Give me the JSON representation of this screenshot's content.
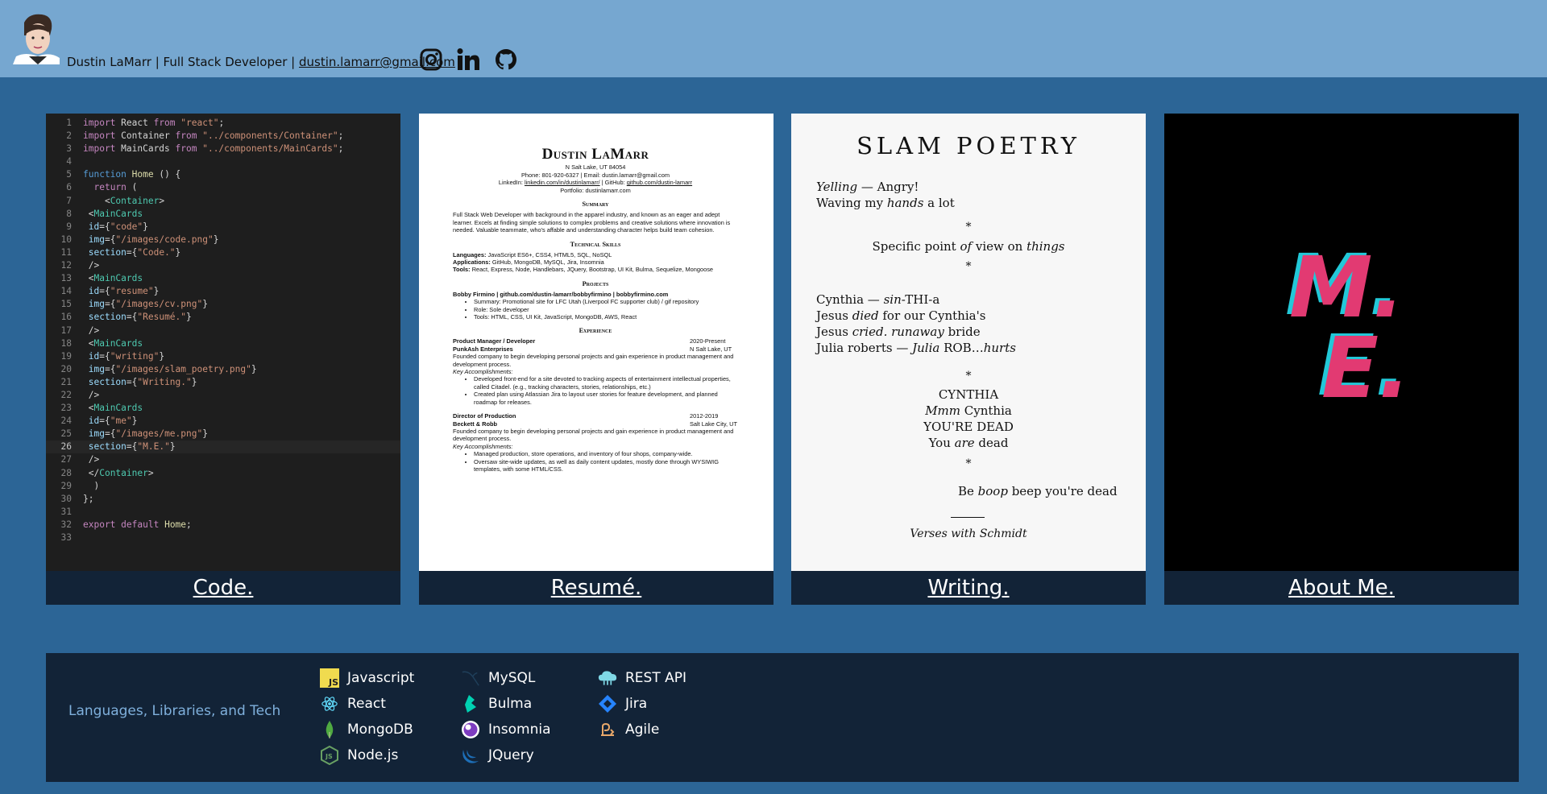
{
  "header": {
    "name_title": "Dustin LaMarr | Full Stack Developer |",
    "email": "dustin.lamarr@gmail.com",
    "social": [
      "instagram-icon",
      "linkedin-icon",
      "github-icon"
    ]
  },
  "cards": [
    {
      "label": "Code."
    },
    {
      "label": "Resumé."
    },
    {
      "label": "Writing."
    },
    {
      "label": "About Me."
    }
  ],
  "code": {
    "lines": [
      "import React from \"react\";",
      "import Container from \"../components/Container\";",
      "import MainCards from \"../components/MainCards\";",
      "",
      "function Home () {",
      "  return (",
      "    <Container>",
      " <MainCards",
      " id={\"code\"}",
      " img={\"/images/code.png\"}",
      " section={\"Code.\"}",
      " />",
      " <MainCards",
      " id={\"resume\"}",
      " img={\"/images/cv.png\"}",
      " section={\"Resumé.\"}",
      " />",
      " <MainCards",
      " id={\"writing\"}",
      " img={\"/images/slam_poetry.png\"}",
      " section={\"Writing.\"}",
      " />",
      " <MainCards",
      " id={\"me\"}",
      " img={\"/images/me.png\"}",
      " section={\"M.E.\"}",
      " />",
      " </Container>",
      "  )",
      "};",
      "",
      "export default Home;",
      ""
    ]
  },
  "resume": {
    "name": "Dustin LaMarr",
    "location": "N Salt Lake, UT 84054",
    "phone_email": "Phone: 801-920-6327 | Email: dustin.lamarr@gmail.com",
    "linkedin_label": "LinkedIn:",
    "linkedin": "linkedin.com/in/dustinlamarr/",
    "github_label": "| GitHub:",
    "github": "github.com/dustin-lamarr",
    "portfolio": "Portfolio: dustinlamarr.com",
    "summary_h": "Summary",
    "summary": "Full Stack Web Developer with background in the apparel industry, and known as an eager and adept learner. Excels at finding simple solutions to complex problems and creative solutions where innovation is needed. Valuable teammate, who's affable and understanding character helps build team cohesion.",
    "skills_h": "Technical Skills",
    "lang_label": "Languages:",
    "lang": "JavaScript ES6+, CSS4, HTML5, SQL, NoSQL",
    "apps_label": "Applications:",
    "apps": "GitHub, MongoDB, MySQL, Jira, Insomnia",
    "tools_label": "Tools:",
    "tools": "React, Express, Node, Handlebars, JQuery, Bootstrap, UI Kit, Bulma, Sequelize, Mongoose",
    "projects_h": "Projects",
    "project_title": "Bobby Firmino | github.com/dustin-lamarr/bobbyfirmino | bobbyfirmino.com",
    "project_items": [
      "Summary: Promotional site for LFC Utah (Liverpool FC supporter club) / gif repository",
      "Role: Sole developer",
      "Tools: HTML, CSS, UI Kit, JavaScript, MongoDB, AWS, React"
    ],
    "exp_h": "Experience",
    "job1_title": "Product Manager / Developer",
    "job1_dates": "2020-Present",
    "job1_company": "PunkAsh Enterprises",
    "job1_loc": "N Salt Lake, UT",
    "job1_desc": "Founded company to begin developing personal projects and gain experience in product management and development process.",
    "key_label": "Key Accomplishments:",
    "job1_items": [
      "Developed front-end for a site devoted to tracking aspects of entertainment intellectual properties, called Citadel. (e.g., tracking characters, stories, relationships, etc.)",
      "Created plan using Atlassian Jira to layout user stories for feature development, and planned roadmap for releases."
    ],
    "job2_title": "Director of Production",
    "job2_dates": "2012-2019",
    "job2_company": "Beckett & Robb",
    "job2_loc": "Salt Lake City, UT",
    "job2_desc": "Founded company to begin developing personal projects and gain experience in product management and development process.",
    "job2_items": [
      "Managed production, store operations, and inventory of four shops, company-wide.",
      "Oversaw site-wide updates, as well as daily content updates, mostly done through WYSIWIG templates, with some HTML/CSS."
    ]
  },
  "poetry": {
    "title": "SLAM POETRY",
    "l1a": "Yelling",
    "l1b": " — Angry!",
    "l2a": "Waving my ",
    "l2b": "hands",
    "l2c": " a lot",
    "star": "*",
    "l3a": "Specific point ",
    "l3b": "of",
    "l3c": " view on ",
    "l3d": "things",
    "l4a": "Cynthia  — ",
    "l4b": "sin",
    "l4c": "-THI-a",
    "l5a": "Jesus ",
    "l5b": "died",
    "l5c": " for our Cynthia's",
    "l6a": "Jesus ",
    "l6b": "cried. runaway",
    "l6c": " bride",
    "l7a": "Julia roberts  — ",
    "l7b": "Julia",
    "l7c": " ROB…",
    "l7d": "hurts",
    "l8": "CYNTHIA",
    "l9a": "Mmm",
    "l9b": " Cynthia",
    "l10": "YOU'RE DEAD",
    "l11a": "You ",
    "l11b": "are",
    "l11c": " dead",
    "l12a": "Be ",
    "l12b": "boop",
    "l12c": " beep you're dead",
    "sign": "Verses with Schmidt"
  },
  "about": {
    "m": "M.",
    "e": "E."
  },
  "tech": {
    "title": "Languages, Libraries, and Tech",
    "items": [
      {
        "label": "Javascript",
        "icon": "javascript-icon"
      },
      {
        "label": "React",
        "icon": "react-icon"
      },
      {
        "label": "MongoDB",
        "icon": "mongodb-icon"
      },
      {
        "label": "Node.js",
        "icon": "nodejs-icon"
      },
      {
        "label": "MySQL",
        "icon": "mysql-icon"
      },
      {
        "label": "Bulma",
        "icon": "bulma-icon"
      },
      {
        "label": "Insomnia",
        "icon": "insomnia-icon"
      },
      {
        "label": "JQuery",
        "icon": "jquery-icon"
      },
      {
        "label": "REST API",
        "icon": "rest-api-icon"
      },
      {
        "label": "Jira",
        "icon": "jira-icon"
      },
      {
        "label": "Agile",
        "icon": "agile-icon"
      }
    ]
  },
  "colors": {
    "page_bg": "#2c6596",
    "header_bg": "#76a7d0",
    "bar_bg": "#122337",
    "me_pink": "#e23a72",
    "me_cyan": "#22c8d8"
  }
}
